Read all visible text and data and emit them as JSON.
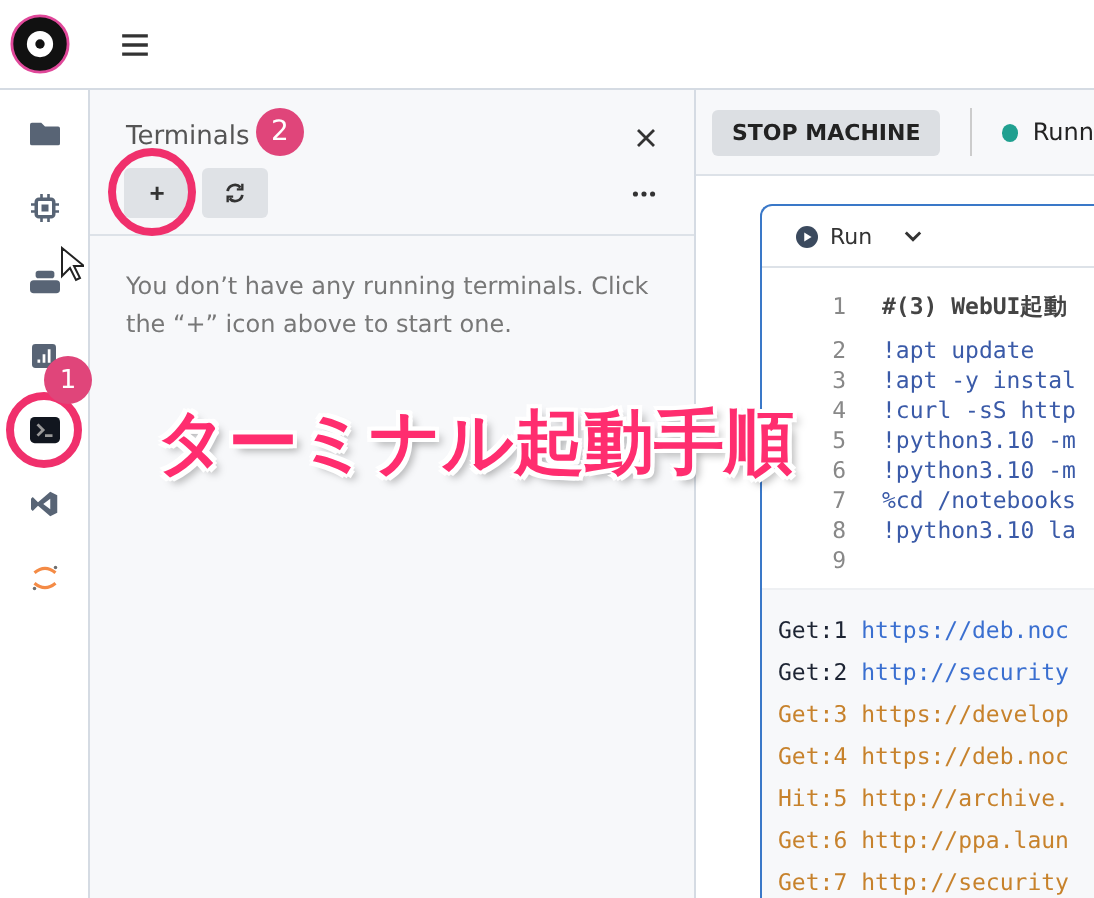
{
  "sidebar": {
    "items": [
      {
        "selected": false
      },
      {
        "selected": false
      },
      {
        "selected": false
      },
      {
        "selected": false
      },
      {
        "selected": true
      },
      {
        "selected": false
      },
      {
        "selected": false
      }
    ]
  },
  "panel": {
    "title": "Terminals",
    "empty_message": "You don’t have any running terminals. Click the “+” icon above to start one.",
    "new_button": "+"
  },
  "toolbar": {
    "stop_button": "STOP MACHINE",
    "status": "Runn"
  },
  "cell": {
    "run_button": "Run",
    "code_lines": [
      {
        "number": "1",
        "text": "#(3) WebUI起動"
      },
      {
        "number": "2",
        "text": "!apt update"
      },
      {
        "number": "3",
        "text": "!apt -y instal"
      },
      {
        "number": "4",
        "text": "!curl -sS http"
      },
      {
        "number": "5",
        "text": "!python3.10 -m"
      },
      {
        "number": "6",
        "text": "!python3.10 -m"
      },
      {
        "number": "7",
        "text": "%cd /notebooks"
      },
      {
        "number": "8",
        "text": "!python3.10 la"
      },
      {
        "number": "9"
      }
    ],
    "output_lines": [
      {
        "kind": "new",
        "label": "Get:1",
        "url": "https://deb.noc"
      },
      {
        "kind": "new",
        "label": "Get:2",
        "url": "http://security"
      },
      {
        "kind": "warn",
        "label": "Get:3",
        "url": "https://develop"
      },
      {
        "kind": "warn",
        "label": "Get:4",
        "url": "https://deb.noc"
      },
      {
        "kind": "warn",
        "label": "Hit:5",
        "url": "http://archive."
      },
      {
        "kind": "warn",
        "label": "Get:6",
        "url": "http://ppa.laun"
      },
      {
        "kind": "warn",
        "label": "Get:7",
        "url": "http://security"
      }
    ]
  },
  "annotations": {
    "title": "ターミナル起動手順",
    "markers": [
      {
        "label": "1"
      },
      {
        "label": "2"
      }
    ]
  }
}
